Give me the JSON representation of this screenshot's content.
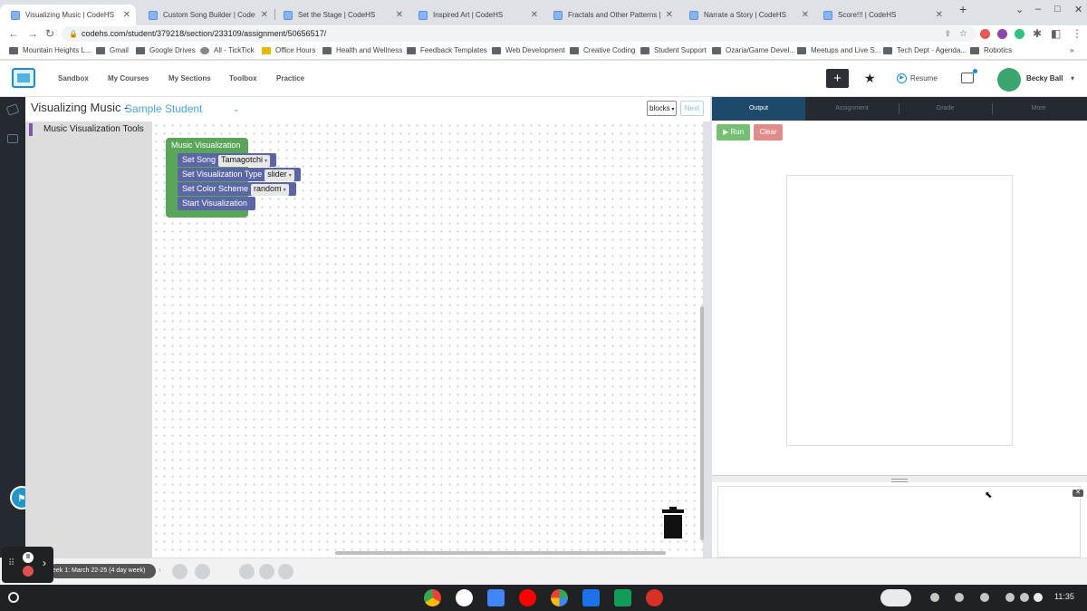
{
  "browser": {
    "tabs": [
      {
        "title": "Visualizing Music | CodeHS",
        "active": true
      },
      {
        "title": "Custom Song Builder | CodeHS",
        "active": false
      },
      {
        "title": "Set the Stage | CodeHS",
        "active": false
      },
      {
        "title": "Inspired Art | CodeHS",
        "active": false
      },
      {
        "title": "Fractals and Other Patterns | Co",
        "active": false
      },
      {
        "title": "Narrate a Story | CodeHS",
        "active": false
      },
      {
        "title": "Score!!! | CodeHS",
        "active": false
      }
    ],
    "url": "codehs.com/student/379218/section/233109/assignment/50656517/",
    "bookmarks": [
      "Mountain Heights L...",
      "Gmail",
      "Google Drives",
      "All - TickTick",
      "Office Hours",
      "Health and Wellness",
      "Feedback Templates",
      "Web Development",
      "Creative Coding",
      "Student Support",
      "Ozaria/Game Devel...",
      "Meetups and Live S...",
      "Tech Dept - Agenda...",
      "Robotics"
    ]
  },
  "nav": {
    "links": [
      "Sandbox",
      "My Courses",
      "My Sections",
      "Toolbox",
      "Practice"
    ],
    "plus": "+",
    "resume": "Resume",
    "user_name": "Becky Ball"
  },
  "editor": {
    "title": "Visualizing Music -",
    "student": "Sample Student",
    "mode": "blocks",
    "next_label": "Next",
    "toolbox_category": "Music Visualization Tools"
  },
  "blocks": {
    "container": "Music Visualization",
    "set_song_label": "Set Song",
    "set_song_value": "Tamagotchi",
    "set_type_label": "Set Visualization Type",
    "set_type_value": "slider",
    "set_color_label": "Set Color Scheme",
    "set_color_value": "random",
    "start_label": "Start Visualization"
  },
  "output": {
    "tabs": [
      "Output",
      "Assignment",
      "Grade",
      "More"
    ],
    "run_label": "Run",
    "clear_label": "Clear"
  },
  "bottom": {
    "week_label": "eek 1: March 22-25 (4 day week)"
  },
  "system": {
    "time": "11:35"
  },
  "colors": {
    "block_container": "#5ba55b",
    "block_statement": "#5b67a5",
    "run_button": "#76c076",
    "clear_button": "#e28b8b",
    "output_tab_active": "#1d4a6b"
  }
}
